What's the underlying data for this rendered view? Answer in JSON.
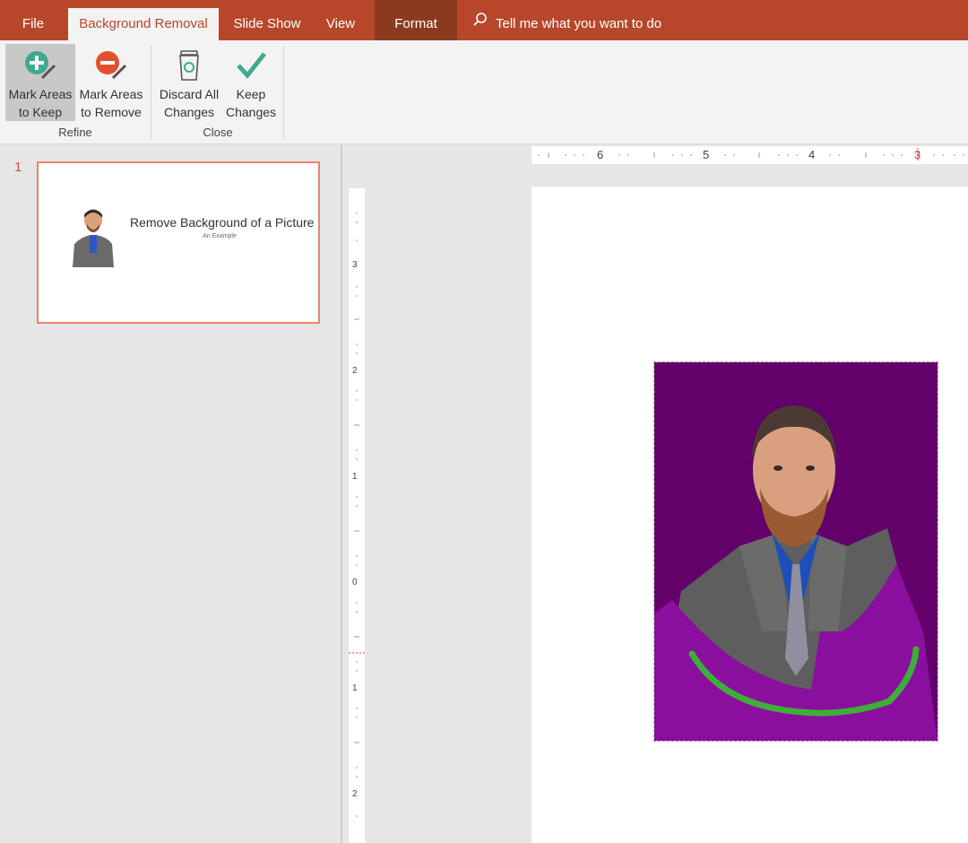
{
  "tabs": {
    "file": "File",
    "background_removal": "Background Removal",
    "slide_show": "Slide Show",
    "view": "View",
    "format": "Format"
  },
  "tell_me": "Tell me what you want to do",
  "ribbon": {
    "mark_keep": [
      "Mark Areas",
      "to Keep"
    ],
    "mark_remove": [
      "Mark Areas",
      "to Remove"
    ],
    "discard": [
      "Discard All",
      "Changes"
    ],
    "keep": [
      "Keep",
      "Changes"
    ],
    "group_refine": "Refine",
    "group_close": "Close"
  },
  "thumbnail": {
    "number": "1",
    "title": "Remove Background of a Picture",
    "subtitle": "An Example"
  },
  "ruler": {
    "h_numbers": [
      "6",
      "5",
      "4",
      "3"
    ],
    "v_numbers": [
      "3",
      "2",
      "1",
      "0",
      "1",
      "2"
    ]
  },
  "colors": {
    "accent": "#b7472a",
    "removed_area": "#8a0f9e",
    "keep_mark": "#3dae3a",
    "thumb_border": "#f0826a"
  },
  "icons": {
    "search": "search-icon",
    "mark_keep": "plus-circle-pencil-icon",
    "mark_remove": "minus-circle-pencil-icon",
    "discard": "recycle-bin-icon",
    "keep": "checkmark-icon"
  }
}
